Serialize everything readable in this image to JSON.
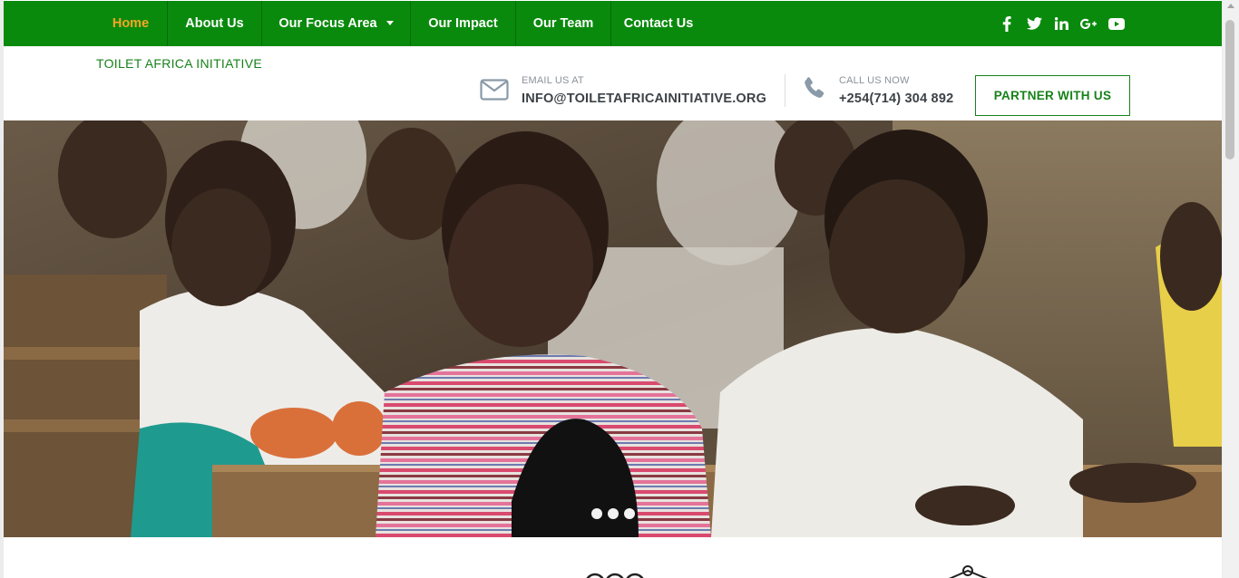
{
  "nav": {
    "items": [
      {
        "label": "Home",
        "active": true
      },
      {
        "label": "About Us"
      },
      {
        "label": "Our Focus Area",
        "dropdown": true
      },
      {
        "label": "Our Impact"
      },
      {
        "label": "Our Team"
      },
      {
        "label": "Contact Us"
      }
    ],
    "social_icons": [
      "facebook-icon",
      "twitter-icon",
      "linkedin-icon",
      "google-plus-icon",
      "youtube-icon"
    ]
  },
  "header": {
    "brand": "TOILET AFRICA INITIATIVE",
    "email_label": "EMAIL US AT",
    "email": "INFO@TOILETAFRICAINITIATIVE.ORG",
    "phone_label": "CALL US NOW",
    "phone": "+254(714) 304 892",
    "cta": "PARTNER WITH US"
  },
  "hero": {
    "slide_count": 3
  },
  "colors": {
    "nav_green": "#0a8a0d",
    "brand_green": "#17821a",
    "active_nav": "#f5a623"
  }
}
